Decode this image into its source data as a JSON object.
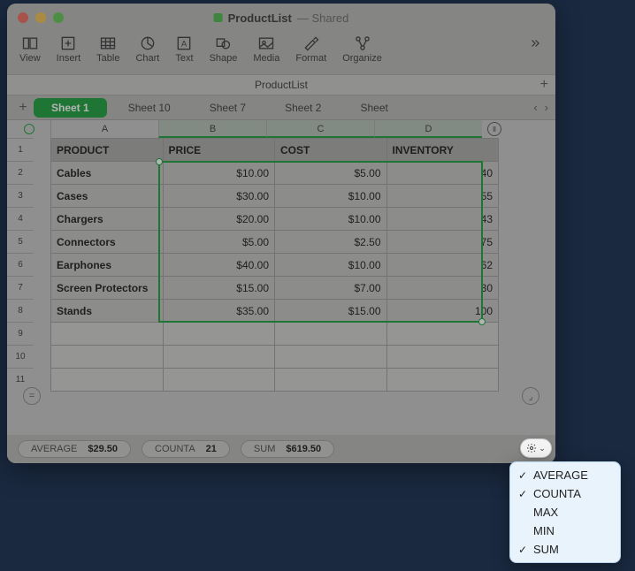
{
  "window": {
    "doc_name": "ProductList",
    "shared_suffix": " — Shared"
  },
  "toolbar": {
    "items": [
      {
        "label": "View",
        "icon": "view"
      },
      {
        "label": "Insert",
        "icon": "insert"
      },
      {
        "label": "Table",
        "icon": "table"
      },
      {
        "label": "Chart",
        "icon": "chart"
      },
      {
        "label": "Text",
        "icon": "text"
      },
      {
        "label": "Shape",
        "icon": "shape"
      },
      {
        "label": "Media",
        "icon": "media"
      },
      {
        "label": "Format",
        "icon": "format"
      },
      {
        "label": "Organize",
        "icon": "organize"
      }
    ]
  },
  "doc_tab": "ProductList",
  "sheets": [
    "Sheet 1",
    "Sheet 10",
    "Sheet 7",
    "Sheet 2",
    "Sheet"
  ],
  "active_sheet_index": 0,
  "columns": [
    "A",
    "B",
    "C",
    "D"
  ],
  "selected_cols": [
    "B",
    "C",
    "D"
  ],
  "row_numbers": [
    "1",
    "2",
    "3",
    "4",
    "5",
    "6",
    "7",
    "8",
    "9",
    "10",
    "11"
  ],
  "table": {
    "headers": [
      "PRODUCT",
      "PRICE",
      "COST",
      "INVENTORY"
    ],
    "rows": [
      {
        "product": "Cables",
        "price": "$10.00",
        "cost": "$5.00",
        "inventory": "40"
      },
      {
        "product": "Cases",
        "price": "$30.00",
        "cost": "$10.00",
        "inventory": "55"
      },
      {
        "product": "Chargers",
        "price": "$20.00",
        "cost": "$10.00",
        "inventory": "43"
      },
      {
        "product": "Connectors",
        "price": "$5.00",
        "cost": "$2.50",
        "inventory": "75"
      },
      {
        "product": "Earphones",
        "price": "$40.00",
        "cost": "$10.00",
        "inventory": "62"
      },
      {
        "product": "Screen Protectors",
        "price": "$15.00",
        "cost": "$7.00",
        "inventory": "30"
      },
      {
        "product": "Stands",
        "price": "$35.00",
        "cost": "$15.00",
        "inventory": "100"
      }
    ],
    "empty_rows": 3
  },
  "status": {
    "average": {
      "label": "AVERAGE",
      "value": "$29.50"
    },
    "counta": {
      "label": "COUNTA",
      "value": "21"
    },
    "sum": {
      "label": "SUM",
      "value": "$619.50"
    }
  },
  "popover": {
    "items": [
      {
        "label": "AVERAGE",
        "checked": true
      },
      {
        "label": "COUNTA",
        "checked": true
      },
      {
        "label": "MAX",
        "checked": false
      },
      {
        "label": "MIN",
        "checked": false
      },
      {
        "label": "SUM",
        "checked": true
      }
    ]
  },
  "glyph": {
    "check": "✓"
  },
  "chart_data": {
    "type": "table",
    "headers": [
      "PRODUCT",
      "PRICE",
      "COST",
      "INVENTORY"
    ],
    "rows": [
      [
        "Cables",
        10.0,
        5.0,
        40
      ],
      [
        "Cases",
        30.0,
        10.0,
        55
      ],
      [
        "Chargers",
        20.0,
        10.0,
        43
      ],
      [
        "Connectors",
        5.0,
        2.5,
        75
      ],
      [
        "Earphones",
        40.0,
        10.0,
        62
      ],
      [
        "Screen Protectors",
        15.0,
        7.0,
        30
      ],
      [
        "Stands",
        35.0,
        15.0,
        100
      ]
    ],
    "aggregates": {
      "AVERAGE": 29.5,
      "COUNTA": 21,
      "SUM": 619.5
    }
  }
}
